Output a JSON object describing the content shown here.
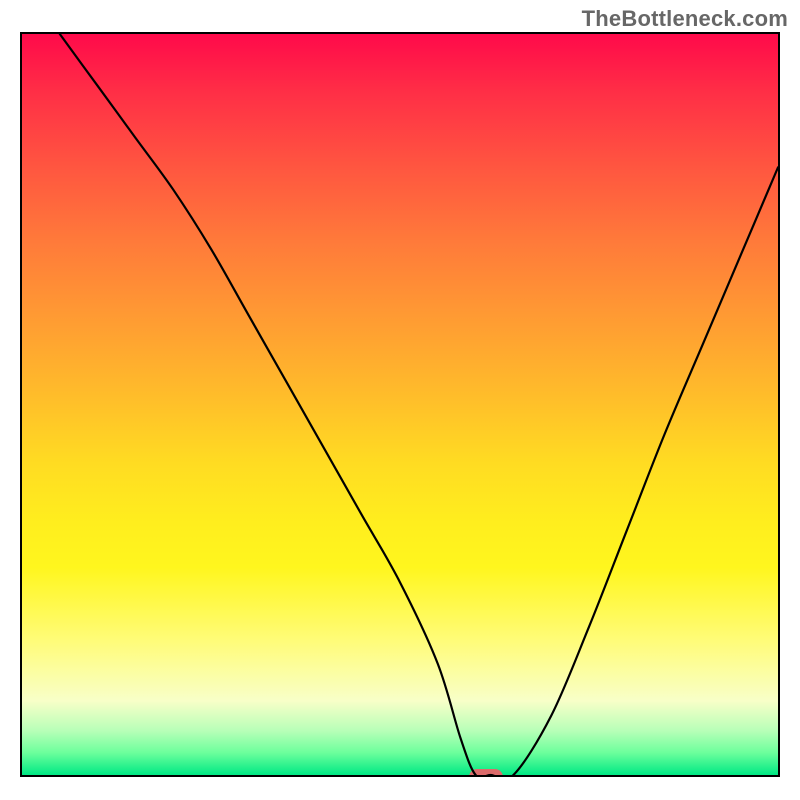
{
  "watermark": "TheBottleneck.com",
  "chart_data": {
    "type": "line",
    "title": "",
    "xlabel": "",
    "ylabel": "",
    "xlim": [
      0,
      100
    ],
    "ylim": [
      0,
      100
    ],
    "x": [
      5,
      10,
      15,
      20,
      25,
      30,
      35,
      40,
      45,
      50,
      55,
      58,
      60,
      62,
      65,
      70,
      75,
      80,
      85,
      90,
      95,
      100
    ],
    "values": [
      100,
      93,
      86,
      79,
      71,
      62,
      53,
      44,
      35,
      26,
      15,
      5,
      0,
      0,
      0,
      8,
      20,
      33,
      46,
      58,
      70,
      82
    ],
    "marker": {
      "x": 61,
      "y": 0,
      "color": "#dc6b6b"
    },
    "gradient_stops": [
      {
        "pos": 0,
        "color": "#ff0a4a"
      },
      {
        "pos": 30,
        "color": "#ff8a36"
      },
      {
        "pos": 60,
        "color": "#ffe81f"
      },
      {
        "pos": 90,
        "color": "#f8ffc8"
      },
      {
        "pos": 100,
        "color": "#00e884"
      }
    ]
  }
}
